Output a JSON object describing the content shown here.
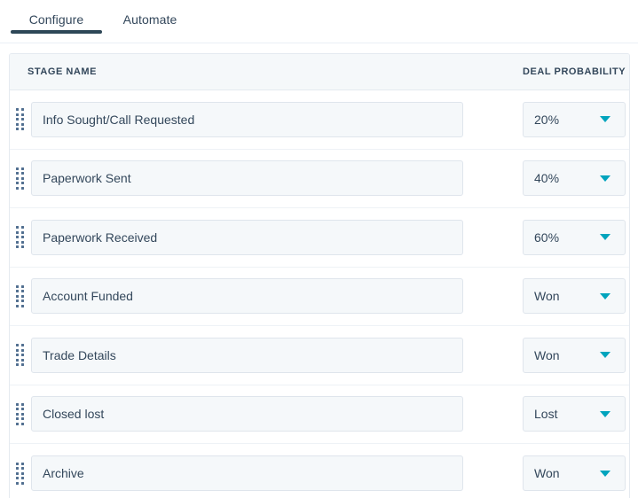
{
  "tabs": [
    {
      "label": "Configure",
      "active": true
    },
    {
      "label": "Automate",
      "active": false
    }
  ],
  "table": {
    "headers": {
      "stage_name": "STAGE NAME",
      "deal_probability": "DEAL PROBABILITY"
    },
    "rows": [
      {
        "stage_name": "Info Sought/Call Requested",
        "deal_probability": "20%"
      },
      {
        "stage_name": "Paperwork Sent",
        "deal_probability": "40%"
      },
      {
        "stage_name": "Paperwork Received",
        "deal_probability": "60%"
      },
      {
        "stage_name": "Account Funded",
        "deal_probability": "Won"
      },
      {
        "stage_name": "Trade Details",
        "deal_probability": "Won"
      },
      {
        "stage_name": "Closed lost",
        "deal_probability": "Lost"
      },
      {
        "stage_name": "Archive",
        "deal_probability": "Won"
      }
    ]
  },
  "icons": {
    "drag_handle": "drag-handle-icon",
    "caret": "chevron-down-icon"
  },
  "colors": {
    "active_tab_underline": "#2e4757",
    "caret_teal": "#00a4bd",
    "text_primary": "#33475b",
    "field_bg": "#f5f8fa",
    "field_border": "#dfe5ec",
    "table_border": "#e5eaf0",
    "row_divider": "#eef2f6",
    "header_bg": "#f5f8fa"
  }
}
